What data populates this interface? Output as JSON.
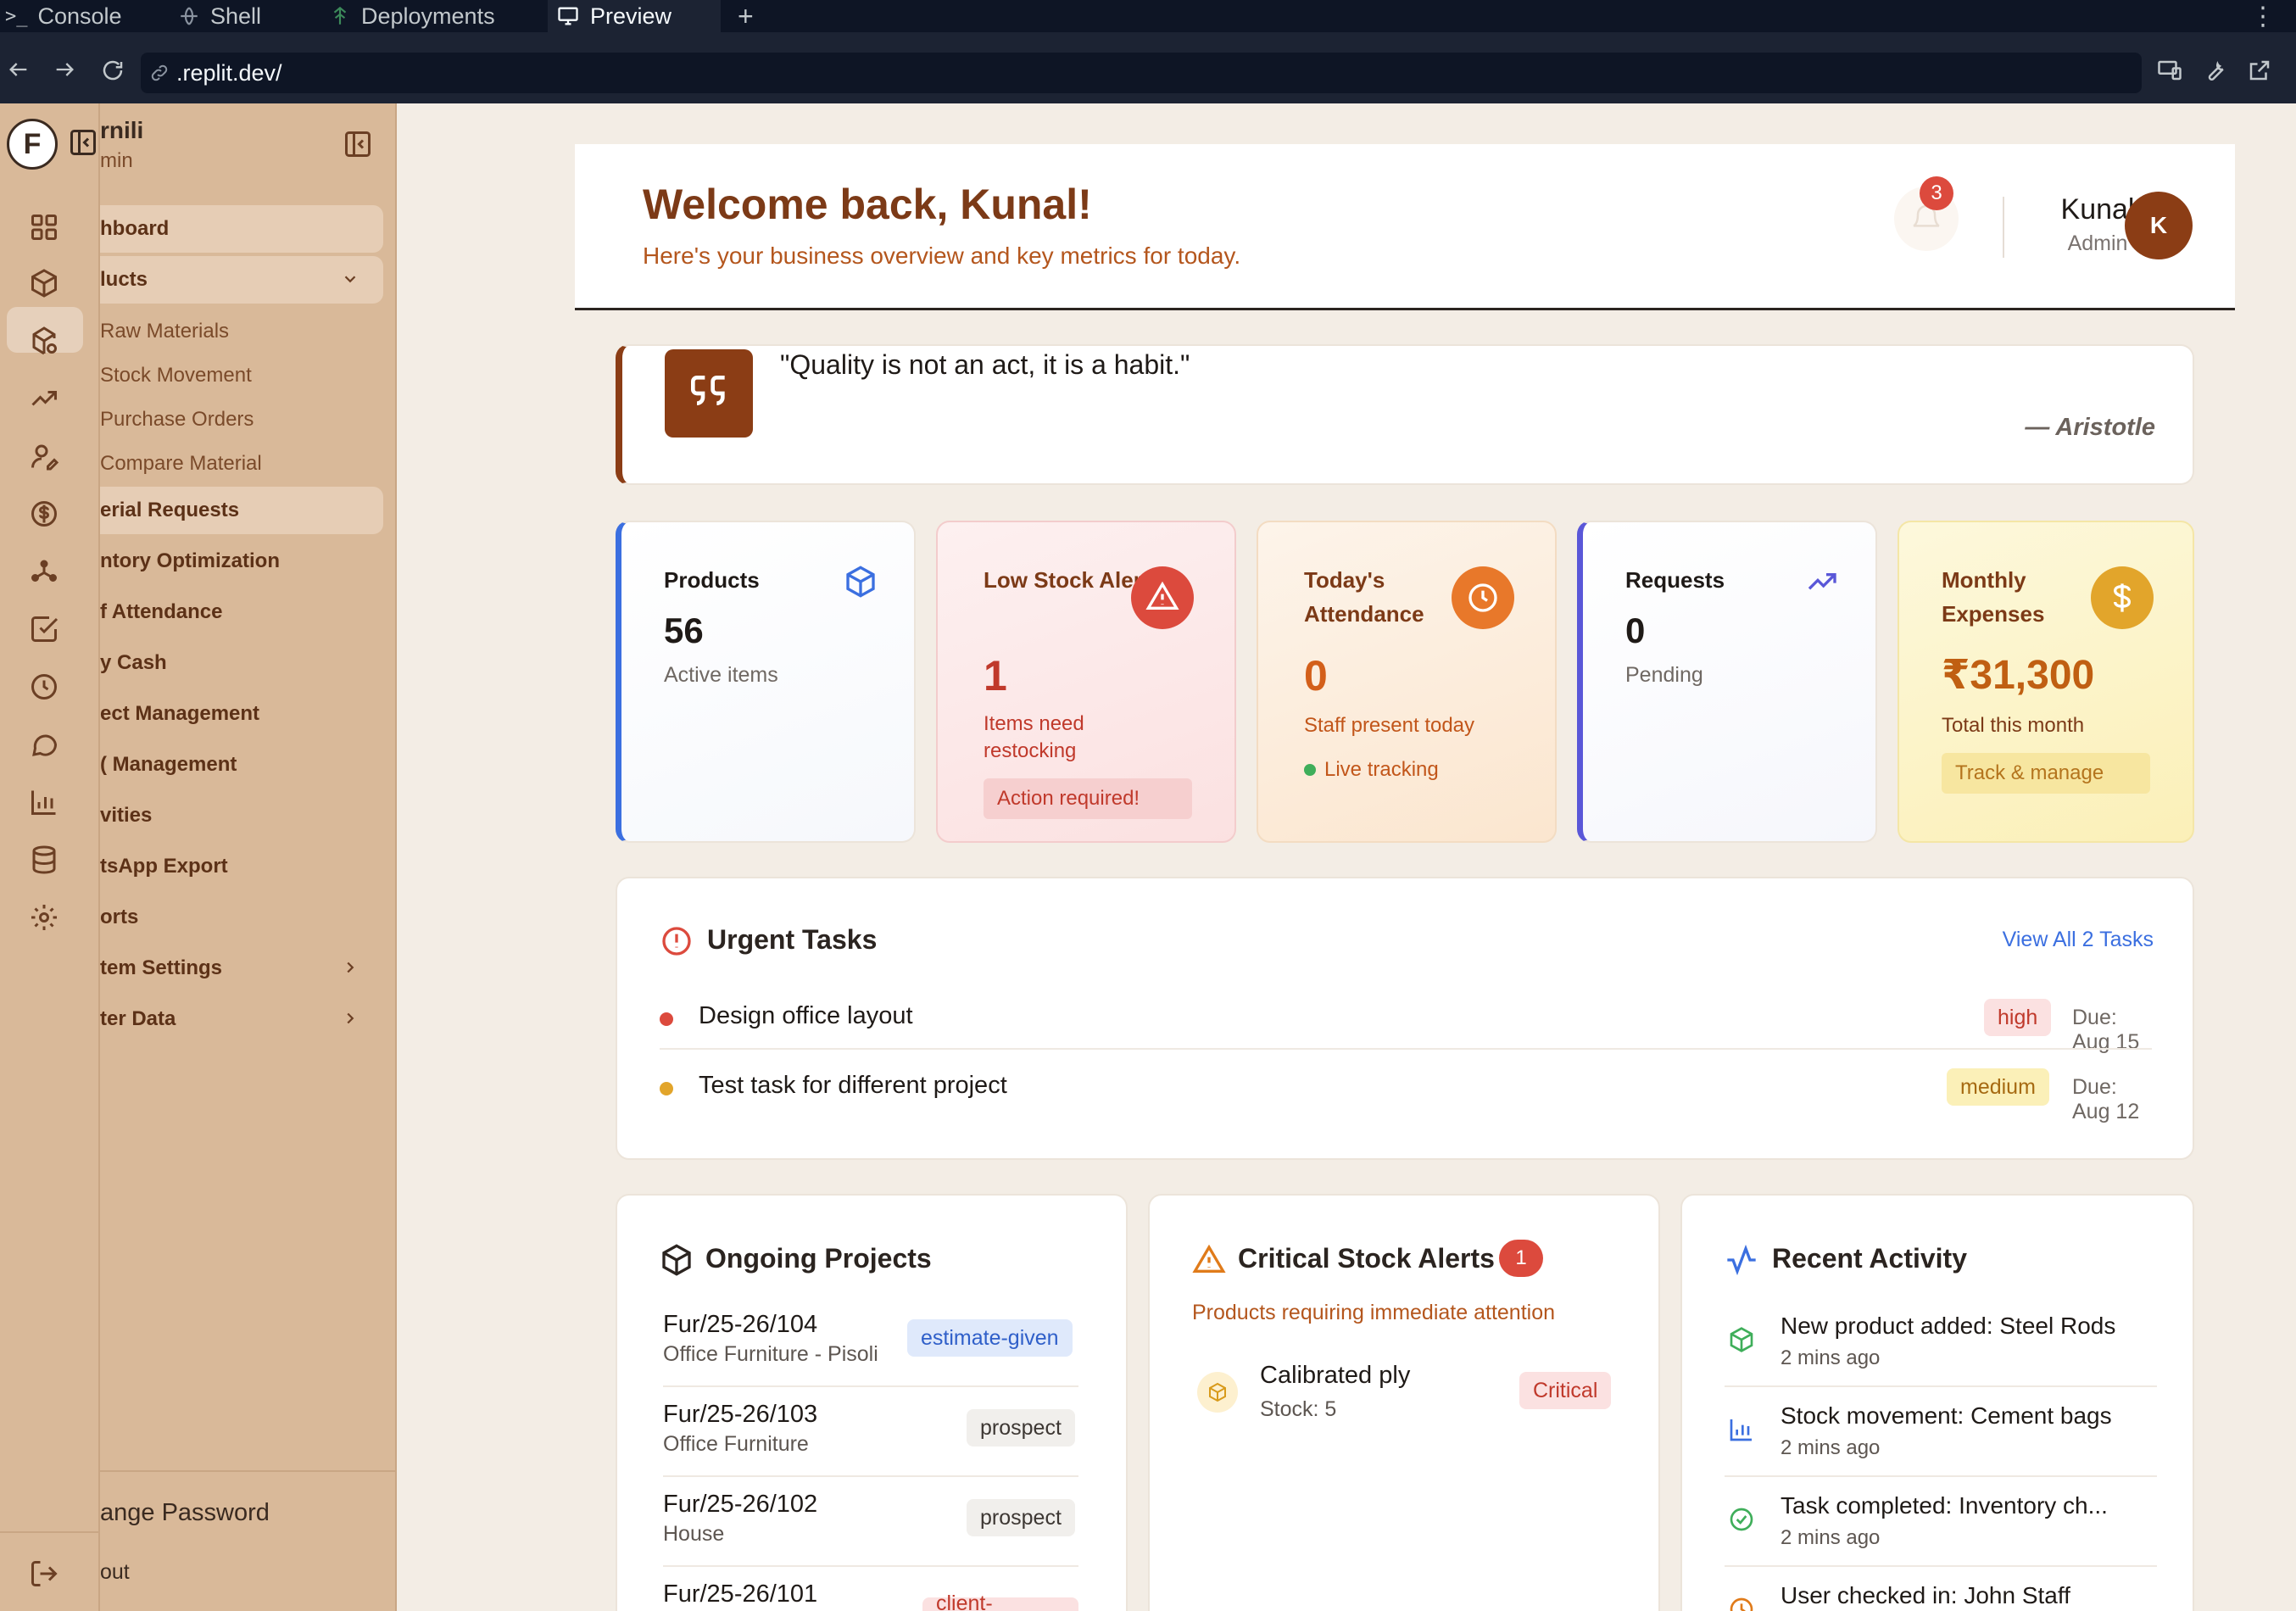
{
  "browser": {
    "tabs": [
      {
        "label": "Console"
      },
      {
        "label": "Shell"
      },
      {
        "label": "Deployments"
      },
      {
        "label": "Preview"
      }
    ],
    "add_tab": "+",
    "menu": "⋮",
    "url": ".replit.dev/"
  },
  "sidebar": {
    "brand_letter": "F",
    "brand_name": "rnili",
    "brand_role": "min",
    "items": [
      {
        "label": "hboard"
      },
      {
        "label": "lucts"
      },
      {
        "label": "Raw Materials"
      },
      {
        "label": "Stock Movement"
      },
      {
        "label": "Purchase Orders"
      },
      {
        "label": "Compare Material"
      },
      {
        "label": "erial Requests"
      },
      {
        "label": "ntory Optimization"
      },
      {
        "label": "f Attendance"
      },
      {
        "label": "y Cash"
      },
      {
        "label": "ect Management"
      },
      {
        "label": "( Management"
      },
      {
        "label": "vities"
      },
      {
        "label": "tsApp Export"
      },
      {
        "label": "orts"
      },
      {
        "label": "tem Settings"
      },
      {
        "label": "ter Data"
      }
    ],
    "change_password": "ange Password",
    "logout": "out"
  },
  "header": {
    "welcome": "Welcome back, Kunal!",
    "subtitle": "Here's your business overview and key metrics for today.",
    "notification_count": "3",
    "user_name": "Kunal",
    "user_role": "Admin",
    "avatar_letter": "K"
  },
  "quote": {
    "text": "\"Quality is not an act, it is a habit.\"",
    "author": "— Aristotle"
  },
  "stats": {
    "products": {
      "label": "Products",
      "value": "56",
      "sub": "Active items"
    },
    "low_stock": {
      "label": "Low Stock Alert",
      "value": "1",
      "sub": "Items need restocking",
      "action": "Action required!"
    },
    "attendance": {
      "label": "Today's Attendance",
      "value": "0",
      "sub": "Staff present today",
      "live": "Live tracking"
    },
    "requests": {
      "label": "Requests",
      "value": "0",
      "sub": "Pending"
    },
    "expenses": {
      "label": "Monthly Expenses",
      "value": "₹31,300",
      "sub": "Total this month",
      "action": "Track & manage"
    }
  },
  "urgent_tasks": {
    "title": "Urgent Tasks",
    "view_all": "View All 2 Tasks",
    "tasks": [
      {
        "name": "Design office layout",
        "priority": "high",
        "due": "Due: Aug 15"
      },
      {
        "name": "Test task for different project",
        "priority": "medium",
        "due": "Due: Aug 12"
      }
    ]
  },
  "projects": {
    "title": "Ongoing Projects",
    "items": [
      {
        "code": "Fur/25-26/104",
        "desc": "Office Furniture - Pisoli",
        "status": "estimate-given"
      },
      {
        "code": "Fur/25-26/103",
        "desc": "Office Furniture",
        "status": "prospect"
      },
      {
        "code": "Fur/25-26/102",
        "desc": "House",
        "status": "prospect"
      },
      {
        "code": "Fur/25-26/101",
        "desc": "",
        "status": "client-approved"
      }
    ]
  },
  "stock_alerts": {
    "title": "Critical Stock Alerts",
    "count": "1",
    "subtitle": "Products requiring immediate attention",
    "items": [
      {
        "name": "Calibrated ply",
        "stock": "Stock: 5",
        "level": "Critical"
      }
    ]
  },
  "activity": {
    "title": "Recent Activity",
    "items": [
      {
        "text": "New product added: Steel Rods",
        "time": "2 mins ago"
      },
      {
        "text": "Stock movement: Cement bags",
        "time": "2 mins ago"
      },
      {
        "text": "Task completed: Inventory ch...",
        "time": "2 mins ago"
      },
      {
        "text": "User checked in: John Staff",
        "time": ""
      }
    ]
  },
  "colors": {
    "brand_brown": "#7c3a17",
    "sidebar_tan": "#d9b999",
    "danger": "#dc4a3d",
    "warning": "#e2a52b",
    "info_blue": "#3b6fe0"
  }
}
